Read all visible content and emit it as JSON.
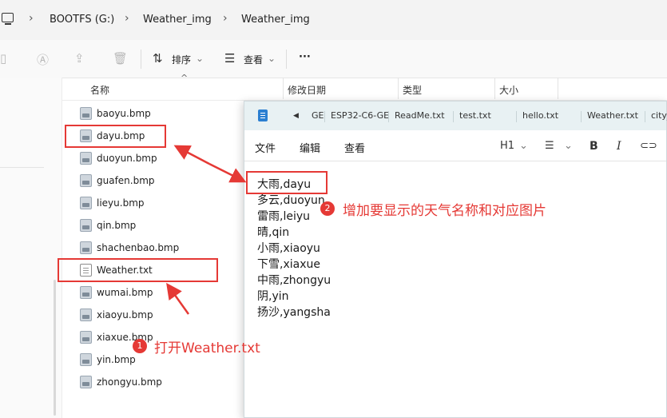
{
  "explorer": {
    "breadcrumb": [
      "BOOTFS (G:)",
      "Weather_img",
      "Weather_img"
    ],
    "toolbar": {
      "sort_label": "排序",
      "view_label": "查看",
      "more_label": "···"
    },
    "columns": [
      "名称",
      "修改日期",
      "类型",
      "大小"
    ],
    "files": [
      {
        "name": "baoyu.bmp",
        "kind": "bmp"
      },
      {
        "name": "dayu.bmp",
        "kind": "bmp"
      },
      {
        "name": "duoyun.bmp",
        "kind": "bmp"
      },
      {
        "name": "guafen.bmp",
        "kind": "bmp"
      },
      {
        "name": "lieyu.bmp",
        "kind": "bmp"
      },
      {
        "name": "qin.bmp",
        "kind": "bmp"
      },
      {
        "name": "shachenbao.bmp",
        "kind": "bmp"
      },
      {
        "name": "Weather.txt",
        "kind": "txt"
      },
      {
        "name": "wumai.bmp",
        "kind": "bmp"
      },
      {
        "name": "xiaoyu.bmp",
        "kind": "bmp"
      },
      {
        "name": "xiaxue.bmp",
        "kind": "bmp"
      },
      {
        "name": "yin.bmp",
        "kind": "bmp"
      },
      {
        "name": "zhongyu.bmp",
        "kind": "bmp"
      }
    ]
  },
  "notepad": {
    "tabs": [
      "GE",
      "ESP32-C6-GE",
      "ReadMe.txt",
      "test.txt",
      "hello.txt",
      "Weather.txt",
      "city_"
    ],
    "menu": [
      "文件",
      "编辑",
      "查看"
    ],
    "format": {
      "heading": "H1",
      "bold": "B",
      "italic": "I"
    },
    "lines": [
      "大雨,dayu",
      "多云,duoyun",
      "雷雨,leiyu",
      "晴,qin",
      "小雨,xiaoyu",
      "下雪,xiaxue",
      "中雨,zhongyu",
      "阴,yin",
      "扬沙,yangsha"
    ]
  },
  "annotations": {
    "step1": {
      "number": "1",
      "text": "打开Weather.txt"
    },
    "step2": {
      "number": "2",
      "text": "增加要显示的天气名称和对应图片"
    },
    "color": "#e53935"
  }
}
